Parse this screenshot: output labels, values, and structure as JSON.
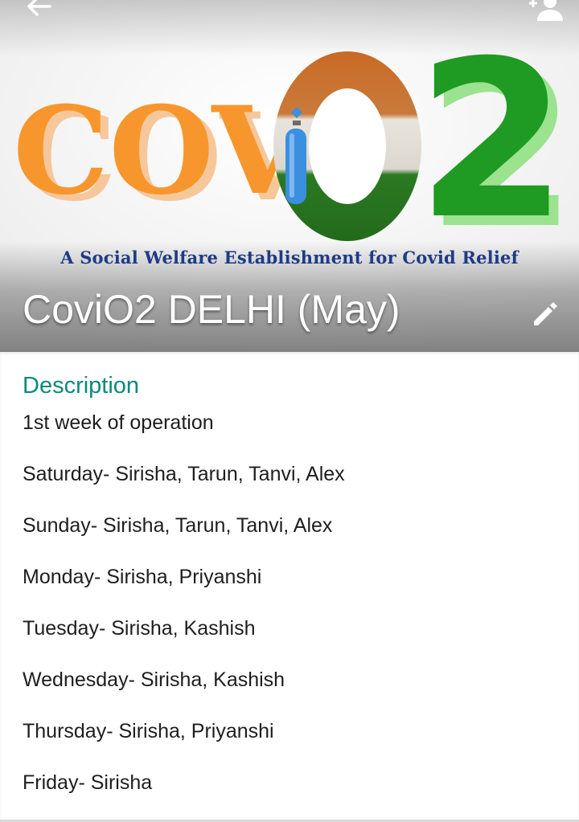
{
  "header": {
    "logo_text": "COVIO2",
    "tagline": "A Social Welfare Establishment for Covid Relief",
    "group_name": "CoviO2 DELHI (May)",
    "back_icon": "arrow-left-icon",
    "add_member_icon": "person-add-icon",
    "edit_icon": "pencil-icon"
  },
  "description": {
    "label": "Description",
    "lines": [
      "1st week of operation",
      "Saturday- Sirisha, Tarun, Tanvi, Alex",
      "Sunday- Sirisha, Tarun, Tanvi, Alex",
      "Monday- Sirisha, Priyanshi",
      "Tuesday- Sirisha, Kashish",
      "Wednesday- Sirisha, Kashish",
      "Thursday- Sirisha, Priyanshi",
      "Friday- Sirisha"
    ]
  },
  "colors": {
    "accent": "#0b8a7a",
    "logo_orange": "#f7962d",
    "logo_green": "#1f9a23",
    "tagline_blue": "#1f3a86",
    "cylinder_blue": "#3b8fe0"
  }
}
